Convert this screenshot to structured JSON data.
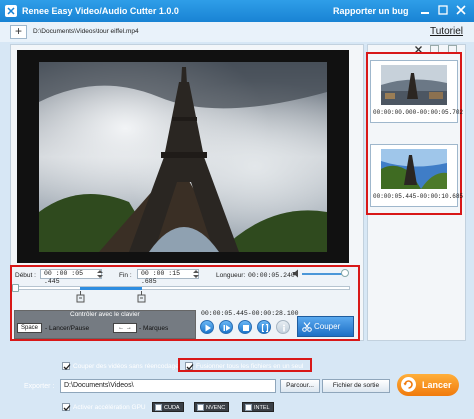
{
  "app": {
    "title": "Renee Easy Video/Audio Cutter 1.0.0",
    "report_bug": "Rapporter un bug"
  },
  "toolbar": {
    "add_label": "+",
    "file_path": "D:\\Documents\\Videos\\tour eiffel.mp4",
    "tutorial": "Tutoriel"
  },
  "controls": {
    "start_label": "Début :",
    "start_value": "00 :00 :05 .445",
    "end_label": "Fin :",
    "end_value": "00 :00 :15 .685",
    "length_label": "Longueur:",
    "length_value": "00:00:05.240",
    "volume": 0.9,
    "selection_time_range": "00:00:05.445-00:00:28.100"
  },
  "keyboard": {
    "title": "Contrôler avec le clavier",
    "space_key": "Space",
    "space_action": "- Lancer/Pause",
    "arrow_keys": "← →",
    "arrow_action": "- Marques"
  },
  "cut_button": "Couper",
  "segments": [
    {
      "time": "00:00:00.000-00:00:05.702"
    },
    {
      "time": "00:00:05.445-00:00:10.685"
    }
  ],
  "bottom": {
    "no_reencode": "Couper des vidéos sans réencodage",
    "merge_all": "Fusionner tous les fichiers en un seul",
    "export_label": "Exporter :",
    "export_path": "D:\\Documents\\Videos\\",
    "browse": "Parcour...",
    "output_file": "Fichier de sortie",
    "launch": "Lancer",
    "gpu_label": "Activer accélération GPU",
    "gpu_options": [
      "CUDA",
      "NVENC",
      "INTEL"
    ]
  },
  "colors": {
    "titlebar": "#1983d4",
    "highlight": "#d81818",
    "accent": "#2e8de0",
    "launch": "#f07a0c"
  }
}
